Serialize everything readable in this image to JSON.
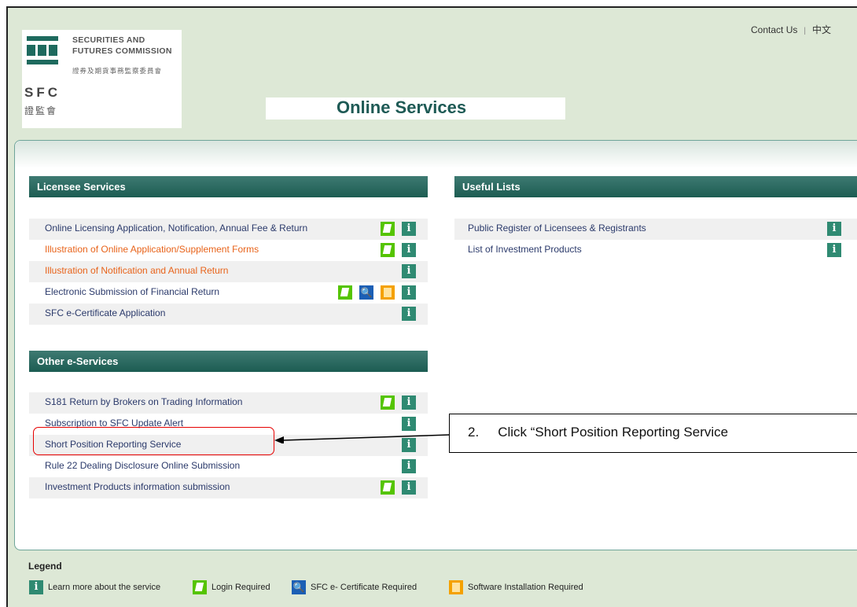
{
  "header": {
    "contact_label": "Contact Us",
    "separator": "|",
    "lang_label": "中文",
    "page_title": "Online Services",
    "logo": {
      "name_line1": "SECURITIES AND",
      "name_line2": "FUTURES COMMISSION",
      "name_zh": "證券及期貨事務監察委員會",
      "short": "SFC",
      "short_zh": "證監會"
    }
  },
  "licensee_services": {
    "heading": "Licensee Services",
    "items": [
      {
        "label": "Online Licensing Application, Notification, Annual Fee & Return",
        "icons": [
          "login",
          "info"
        ]
      },
      {
        "label": "Illustration of Online Application/Supplement Forms",
        "icons": [
          "login",
          "info"
        ]
      },
      {
        "label": "Illustration of Notification and Annual Return",
        "icons": [
          "info"
        ]
      },
      {
        "label": "Electronic Submission of Financial Return",
        "icons": [
          "login",
          "key",
          "software",
          "info"
        ]
      },
      {
        "label": "SFC e-Certificate Application",
        "icons": [
          "info"
        ]
      }
    ]
  },
  "useful_lists": {
    "heading": "Useful Lists",
    "items": [
      {
        "label": "Public Register of Licensees & Registrants",
        "icons": [
          "info"
        ]
      },
      {
        "label": "List of Investment Products",
        "icons": [
          "info"
        ]
      }
    ]
  },
  "other_eservices": {
    "heading": "Other e-Services",
    "items": [
      {
        "label": "S181 Return by Brokers on Trading Information",
        "icons": [
          "login",
          "info"
        ]
      },
      {
        "label": "Subscription to SFC Update Alert",
        "icons": [
          "info"
        ]
      },
      {
        "label": "Short Position Reporting Service",
        "icons": [
          "info"
        ]
      },
      {
        "label": "Rule 22 Dealing Disclosure Online Submission",
        "icons": [
          "info"
        ]
      },
      {
        "label": "Investment Products information submission",
        "icons": [
          "login",
          "info"
        ]
      }
    ]
  },
  "callout": {
    "number": "2.",
    "text": "Click “Short Position Reporting Service"
  },
  "legend": {
    "title": "Legend",
    "items": [
      {
        "icon": "info-icon",
        "label": "Learn more about the service"
      },
      {
        "icon": "login-icon",
        "label": "Login Required"
      },
      {
        "icon": "key-icon",
        "label": "SFC e- Certificate Required"
      },
      {
        "icon": "software-icon",
        "label": "Software Installation Required"
      }
    ]
  },
  "icon_glyphs": {
    "info": "i",
    "key": "🔍"
  },
  "colors": {
    "accent": "#1e5a55",
    "header_bar": "#2b6d63",
    "orange_link": "#e8631a",
    "highlight": "#e60000"
  }
}
